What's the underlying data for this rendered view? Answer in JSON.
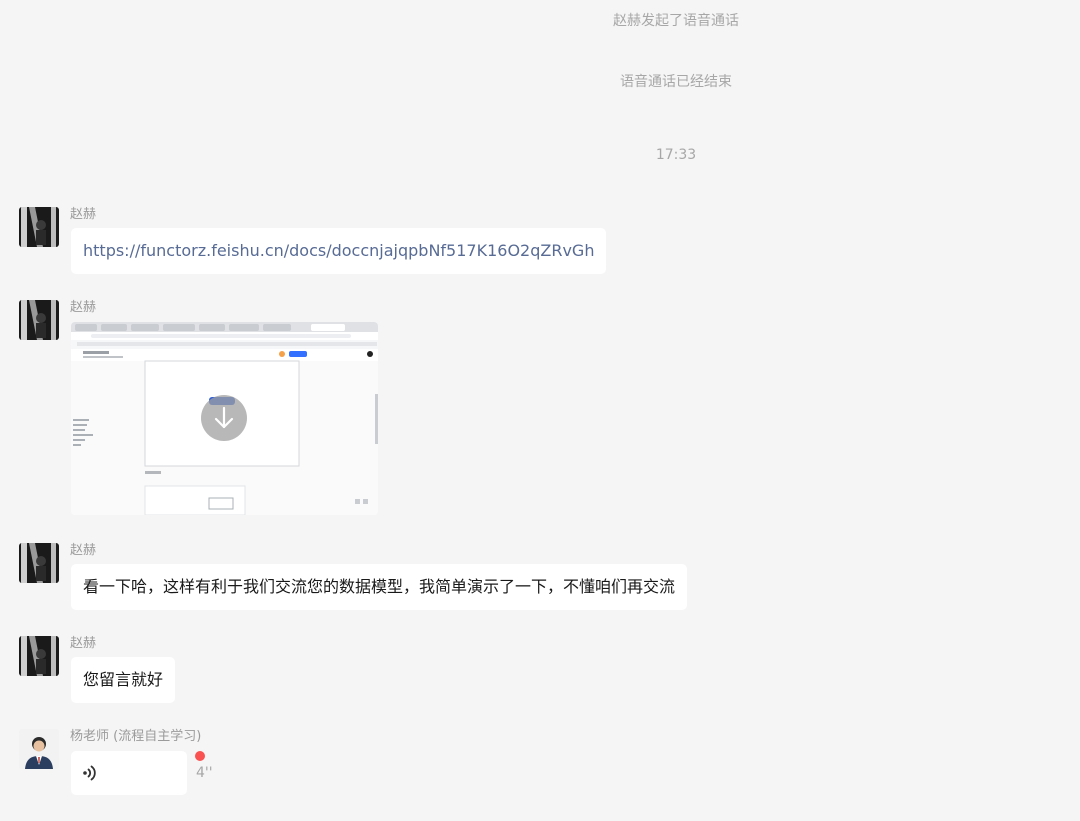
{
  "system_messages": {
    "call_started": "赵赫发起了语音通话",
    "call_ended": "语音通话已经结束",
    "timestamp": "17:33"
  },
  "messages": [
    {
      "sender": "赵赫",
      "type": "link",
      "text": "https://functorz.feishu.cn/docs/doccnjajqpbNf517K16O2qZRvGh"
    },
    {
      "sender": "赵赫",
      "type": "image"
    },
    {
      "sender": "赵赫",
      "type": "text",
      "text": "看一下哈，这样有利于我们交流您的数据模型，我简单演示了一下，不懂咱们再交流"
    },
    {
      "sender": "赵赫",
      "type": "text",
      "text": "您留言就好"
    },
    {
      "sender": "杨老师 (流程自主学习)",
      "type": "voice",
      "duration": "4''",
      "unread": true
    }
  ],
  "colors": {
    "background": "#f5f5f5",
    "bubble": "#ffffff",
    "link": "#576b95",
    "unread_dot": "#fa5151",
    "meta_text": "#a7a7a7"
  },
  "icons": {
    "image_overlay": "download-arrow-icon",
    "voice": "voice-wave-icon"
  }
}
